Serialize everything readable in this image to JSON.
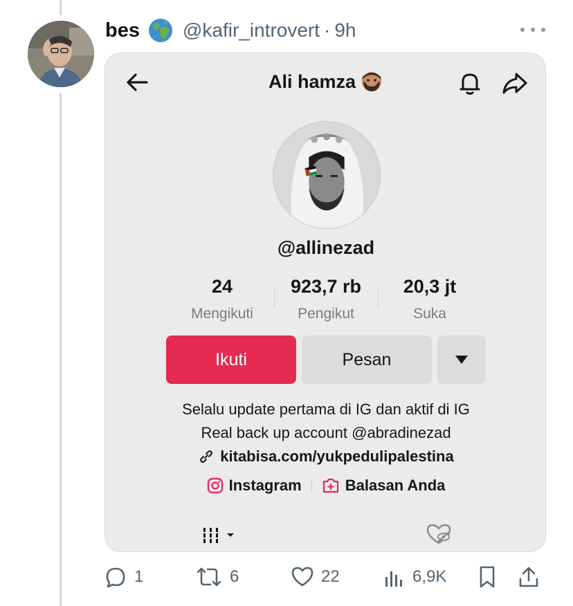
{
  "tweet": {
    "display_name": "bes",
    "name_emoji": "earth-globe-africa-icon",
    "handle": "@kafir_introvert",
    "separator": "·",
    "time": "9h"
  },
  "profile": {
    "title": "Ali hamza",
    "title_emoji": "man-beard-emoji-icon",
    "username": "@allinezad",
    "stats": [
      {
        "value": "24",
        "label": "Mengikuti"
      },
      {
        "value": "923,7 rb",
        "label": "Pengikut"
      },
      {
        "value": "20,3 jt",
        "label": "Suka"
      }
    ],
    "buttons": {
      "follow": "Ikuti",
      "message": "Pesan"
    },
    "bio_lines": [
      "Selalu update pertama di IG dan aktif di IG",
      "Real back up account @abradinezad"
    ],
    "link": "kitabisa.com/yukpedulipalestina",
    "social": {
      "instagram": "Instagram",
      "replies": "Balasan Anda"
    }
  },
  "actions": {
    "replies": "1",
    "retweets": "6",
    "likes": "22",
    "views": "6,9K"
  },
  "colors": {
    "follow_button": "#e62b50",
    "instagram_icon": "#e1306c",
    "muted_text": "#536471"
  }
}
